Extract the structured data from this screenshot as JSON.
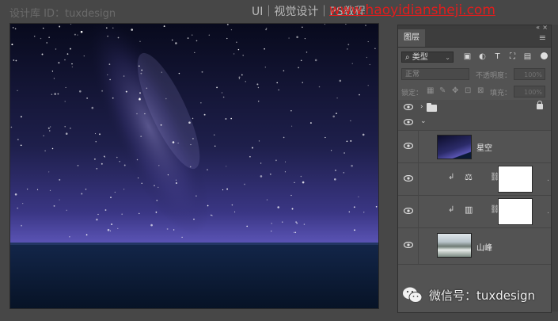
{
  "watermarks": {
    "left": "设计库 ID：tuxdesign",
    "middle": "UI｜视觉设计｜PS教程",
    "url": "www.haoyidiansheji.com"
  },
  "panel": {
    "tab": "图层",
    "filter": {
      "kind": "类型",
      "icons": [
        "image-filter-icon",
        "adjustment-filter-icon",
        "text-filter-icon",
        "shape-filter-icon",
        "smart-object-filter-icon"
      ]
    },
    "blend_mode": "正常",
    "opacity_label": "不透明度：",
    "opacity_value": "100%",
    "lock_label": "锁定：",
    "fill_label": "填充：",
    "fill_value": "100%",
    "layers": [
      {
        "type": "group",
        "name": "",
        "locked": true
      },
      {
        "type": "group-expanded",
        "name": ""
      },
      {
        "type": "smart-object",
        "name": "星空"
      },
      {
        "type": "adjustment",
        "icon": "balance-icon",
        "clipped": true
      },
      {
        "type": "adjustment",
        "icon": "gradient-map-icon",
        "clipped": true
      },
      {
        "type": "smart-object",
        "name": "山峰"
      }
    ]
  },
  "wechat": {
    "text": "微信号：tuxdesign"
  },
  "colors": {
    "canvas_sky_top": "#090c22",
    "canvas_sky_mid": "#27285b",
    "canvas_glow": "#5a55b3",
    "canvas_ground": "#0a1a34"
  }
}
